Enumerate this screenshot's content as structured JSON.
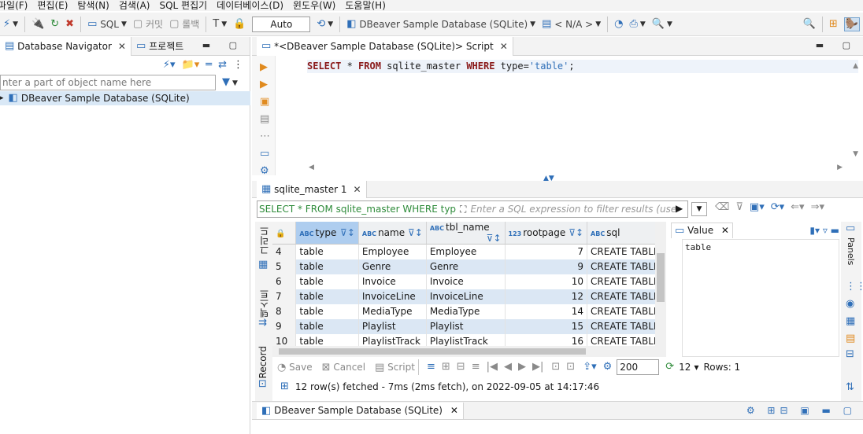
{
  "menu": [
    "파일(F)",
    "편집(E)",
    "탐색(N)",
    "검색(A)",
    "SQL 편집기",
    "데이터베이스(D)",
    "윈도우(W)",
    "도움말(H)"
  ],
  "toolbar": {
    "sql_label": "SQL",
    "commit_label": "커밋",
    "rollback_label": "롤백",
    "transaction_mode": "Auto",
    "datasource": "DBeaver Sample Database (SQLite)",
    "schema": "< N/A >"
  },
  "navigator": {
    "tab_label": "Database Navigator",
    "project_tab_label": "프로젝트",
    "filter_placeholder": "nter a part of object name here",
    "tree_item": "DBeaver Sample Database (SQLite)"
  },
  "editor": {
    "tab_label": "*<DBeaver Sample Database (SQLite)> Script",
    "sql_keyword_select": "SELECT",
    "sql_star": " * ",
    "sql_keyword_from": "FROM",
    "sql_table": " sqlite_master ",
    "sql_keyword_where": "WHERE",
    "sql_column": " type=",
    "sql_string": "'table'",
    "sql_end": ";"
  },
  "results": {
    "tab_label": "sqlite_master 1",
    "query_text": "SELECT * FROM sqlite_master WHERE typ",
    "filter_placeholder": "Enter a SQL expression to filter results (use",
    "columns": [
      {
        "tag": "ABC",
        "name": "type"
      },
      {
        "tag": "ABC",
        "name": "name"
      },
      {
        "tag": "ABC",
        "name": "tbl_name"
      },
      {
        "tag": "123",
        "name": "rootpage"
      },
      {
        "tag": "ABC",
        "name": "sql"
      }
    ],
    "rows": [
      {
        "n": "4",
        "type": "table",
        "name": "Employee",
        "tbl_name": "Employee",
        "rootpage": "7",
        "sql": "CREATE TABLE"
      },
      {
        "n": "5",
        "type": "table",
        "name": "Genre",
        "tbl_name": "Genre",
        "rootpage": "9",
        "sql": "CREATE TABLE"
      },
      {
        "n": "6",
        "type": "table",
        "name": "Invoice",
        "tbl_name": "Invoice",
        "rootpage": "10",
        "sql": "CREATE TABLE"
      },
      {
        "n": "7",
        "type": "table",
        "name": "InvoiceLine",
        "tbl_name": "InvoiceLine",
        "rootpage": "12",
        "sql": "CREATE TABLE"
      },
      {
        "n": "8",
        "type": "table",
        "name": "MediaType",
        "tbl_name": "MediaType",
        "rootpage": "14",
        "sql": "CREATE TABLE"
      },
      {
        "n": "9",
        "type": "table",
        "name": "Playlist",
        "tbl_name": "Playlist",
        "rootpage": "15",
        "sql": "CREATE TABLE"
      },
      {
        "n": "10",
        "type": "table",
        "name": "PlaylistTrack",
        "tbl_name": "PlaylistTrack",
        "rootpage": "16",
        "sql": "CREATE TABLE"
      }
    ],
    "value_panel_title": "Value",
    "value_text": "table",
    "side_tabs": [
      "그리드",
      "텍스트",
      "Record"
    ],
    "panels_label": "Panels",
    "save_label": "Save",
    "cancel_label": "Cancel",
    "script_label": "Script",
    "fetch_size": "200",
    "refresh_count": "12",
    "rows_label": "Rows: 1",
    "status": "12 row(s) fetched - 7ms (2ms fetch), on 2022-09-05 at 14:17:46"
  },
  "bottom_tab": "DBeaver Sample Database (SQLite)"
}
